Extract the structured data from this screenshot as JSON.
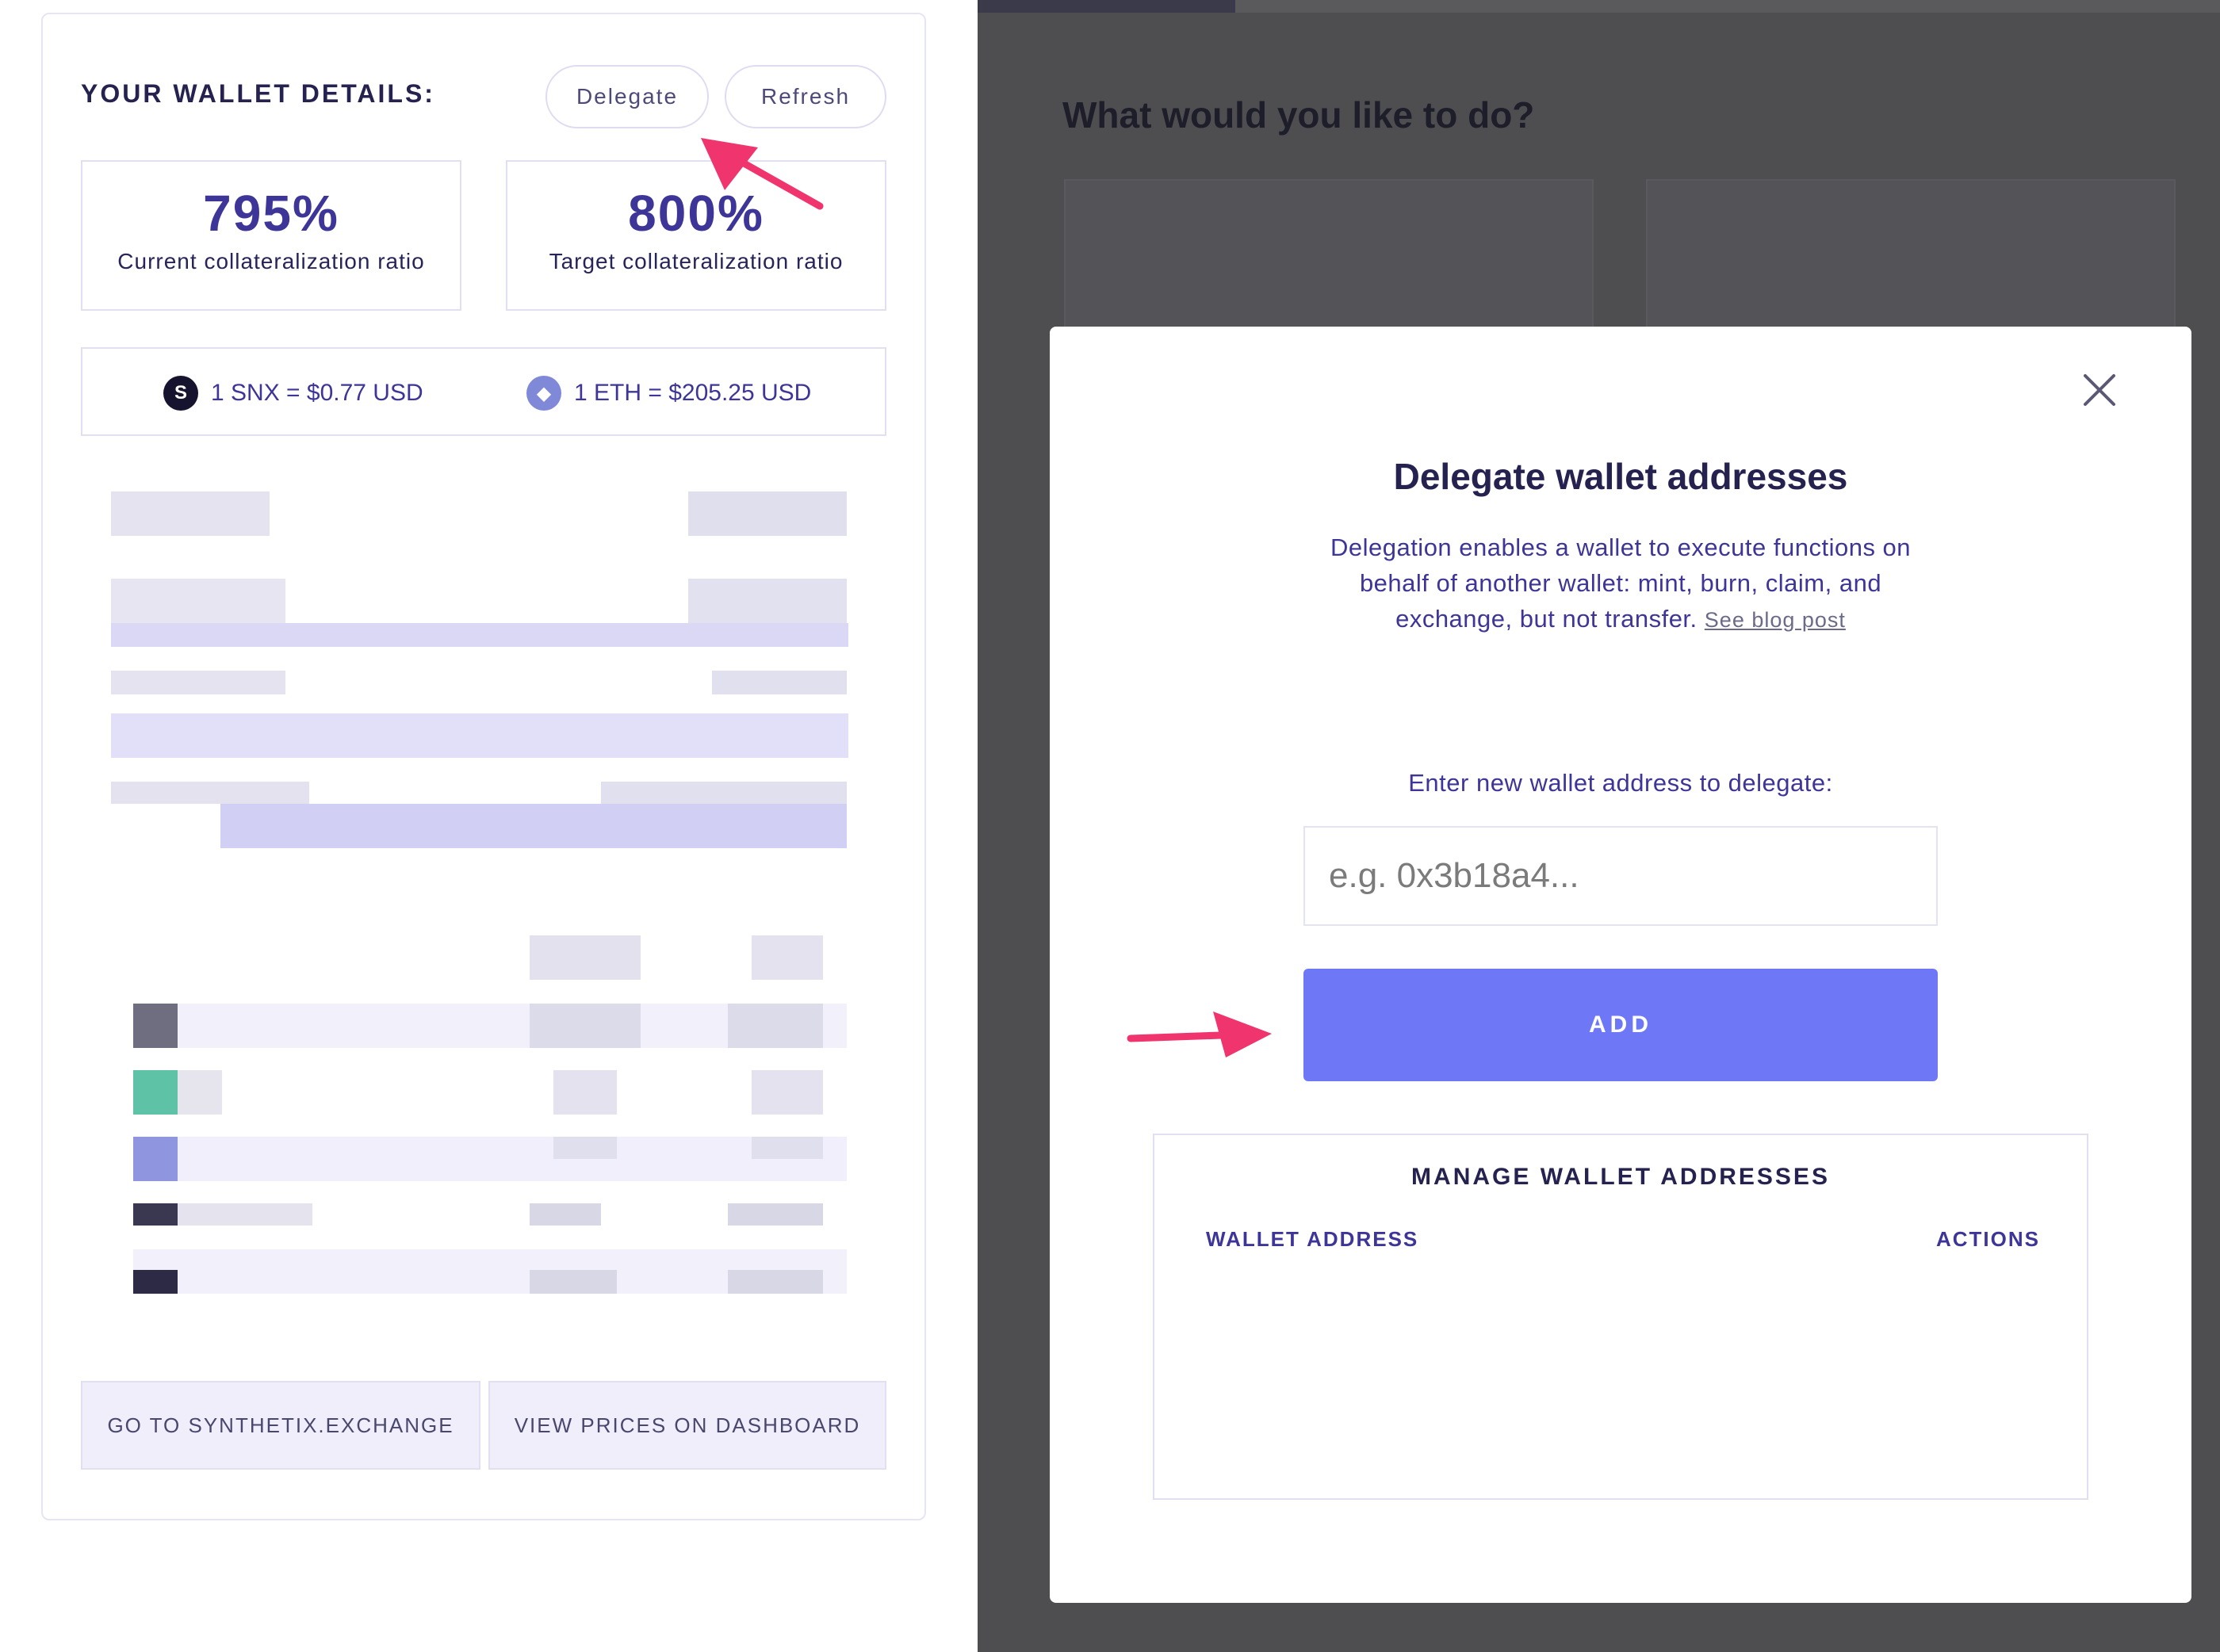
{
  "left_panel": {
    "title": "YOUR WALLET DETAILS:",
    "delegate_label": "Delegate",
    "refresh_label": "Refresh",
    "ratios": [
      {
        "value": "795%",
        "label": "Current collateralization ratio"
      },
      {
        "value": "800%",
        "label": "Target collateralization ratio"
      }
    ],
    "prices": {
      "snx": {
        "icon": "snx-icon",
        "glyph": "S",
        "text": "1 SNX = $0.77 USD"
      },
      "eth": {
        "icon": "eth-icon",
        "glyph": "◆",
        "text": "1 ETH = $205.25 USD"
      }
    },
    "exchange_button": "GO TO SYNTHETIX.EXCHANGE",
    "dashboard_button": "VIEW PRICES ON DASHBOARD"
  },
  "background": {
    "heading": "What would you like to do?"
  },
  "modal": {
    "close_icon": "close-icon",
    "title": "Delegate wallet addresses",
    "description": "Delegation enables a wallet to execute functions on behalf of another wallet: mint, burn, claim, and exchange, but not transfer.",
    "blog_link": "See blog post",
    "input_label": "Enter new wallet address to delegate:",
    "input_placeholder": "e.g. 0x3b18a4...",
    "add_button": "ADD",
    "manage": {
      "title": "MANAGE WALLET ADDRESSES",
      "col_address": "WALLET ADDRESS",
      "col_actions": "ACTIONS"
    }
  },
  "colors": {
    "accent": "#6e77f6",
    "text_primary": "#252250",
    "text_purple": "#3d3597",
    "annotation_arrow": "#f0346e",
    "overlay": "#4e4d50"
  }
}
